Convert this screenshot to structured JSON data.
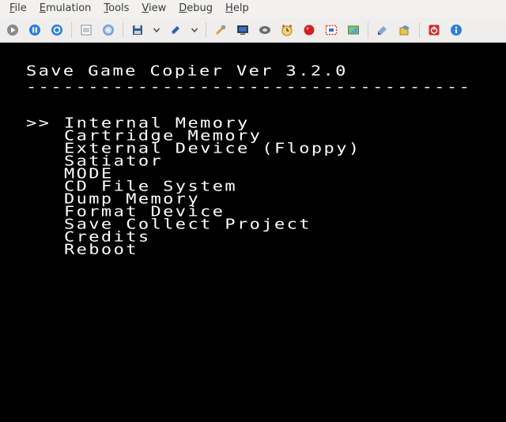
{
  "menubar": {
    "items": [
      {
        "label": "File"
      },
      {
        "label": "Emulation"
      },
      {
        "label": "Tools"
      },
      {
        "label": "View"
      },
      {
        "label": "Debug"
      },
      {
        "label": "Help"
      }
    ]
  },
  "toolbar": {
    "icons": [
      "play-icon",
      "pause-icon",
      "reset-icon",
      "screenshot-icon",
      "disc-icon",
      "save-state-icon",
      "load-state-icon",
      "settings-icon",
      "display-icon",
      "cd-drive-icon",
      "timer-icon",
      "memory-icon",
      "debug-view-icon",
      "controller-icon",
      "cheats-icon",
      "backup-icon",
      "stop-icon",
      "info-icon"
    ]
  },
  "screen": {
    "title": "Save Game Copier Ver 3.2.0",
    "divider": "------------------------------------",
    "cursor": ">>",
    "options": [
      "Internal Memory",
      "Cartridge Memory",
      "External Device (Floppy)",
      "Satiator",
      "MODE",
      "CD File System",
      "Dump Memory",
      "Format Device",
      "Save Collect Project",
      "Credits",
      "Reboot"
    ],
    "selected_index": 0,
    "colors": {
      "background": "#000000",
      "text": "#ffffff"
    }
  }
}
